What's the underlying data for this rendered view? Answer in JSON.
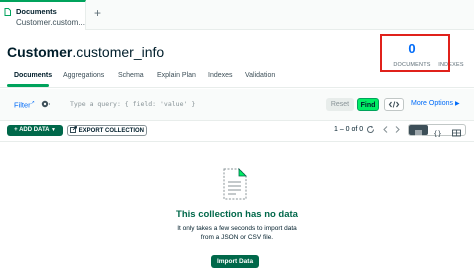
{
  "tabs": {
    "active": {
      "title": "Documents",
      "subtitle": "Customer.custom..."
    },
    "new_tab_label": "+"
  },
  "header": {
    "db_name": "Customer",
    "collection_name": ".customer_info",
    "documents_count": "0",
    "documents_label": "DOCUMENTS",
    "indexes_label": "INDEXES"
  },
  "subtabs": [
    "Documents",
    "Aggregations",
    "Schema",
    "Explain Plan",
    "Indexes",
    "Validation"
  ],
  "query": {
    "filter_label": "Filter",
    "placeholder": "Type a query: { field: 'value' }",
    "reset_label": "Reset",
    "find_label": "Find",
    "more_options_label": "More Options"
  },
  "toolbar": {
    "add_data_label": "ADD DATA",
    "export_label": "EXPORT COLLECTION",
    "pagination": "1 – 0 of 0"
  },
  "empty_state": {
    "title": "This collection has no data",
    "description": "It only takes a few seconds to import data from a JSON or CSV file.",
    "import_label": "Import Data"
  },
  "icons": {
    "tab": "documents-icon",
    "options": "gear-icon",
    "code": "code-icon",
    "refresh": "refresh-icon",
    "prev": "chevron-left-icon",
    "next": "chevron-right-icon",
    "views": [
      "list-view-icon",
      "json-view-icon",
      "table-view-icon"
    ],
    "empty": "document-icon"
  },
  "colors": {
    "brand_green": "#00684a",
    "accent_green": "#00ed64",
    "link_blue": "#016bf8",
    "highlight_red": "#e0211b"
  }
}
